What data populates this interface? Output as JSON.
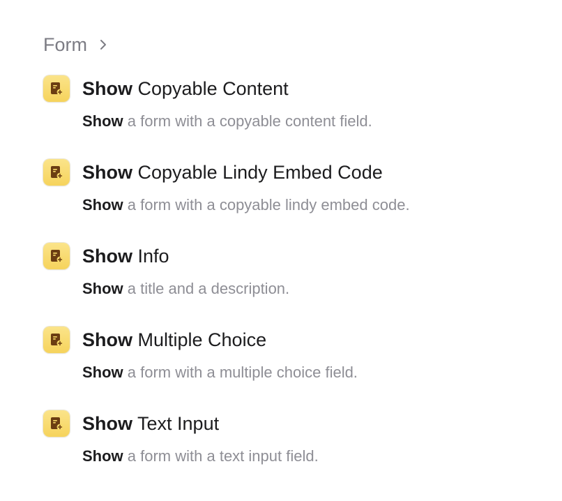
{
  "breadcrumb": {
    "label": "Form",
    "icon": "chevron-right-icon"
  },
  "colors": {
    "icon_background": "#f8da6a",
    "icon_glyph": "#6b3d12",
    "title_text": "#1c1c1e",
    "muted_text": "#8e8e95"
  },
  "actions": [
    {
      "icon": "form-add-icon",
      "title_verb": "Show",
      "title_rest": " Copyable Content",
      "desc_verb": "Show",
      "desc_rest": " a form with a copyable content field."
    },
    {
      "icon": "form-add-icon",
      "title_verb": "Show",
      "title_rest": " Copyable Lindy Embed Code",
      "desc_verb": "Show",
      "desc_rest": " a form with a copyable lindy embed code."
    },
    {
      "icon": "form-add-icon",
      "title_verb": "Show",
      "title_rest": " Info",
      "desc_verb": "Show",
      "desc_rest": " a title and a description."
    },
    {
      "icon": "form-add-icon",
      "title_verb": "Show",
      "title_rest": " Multiple Choice",
      "desc_verb": "Show",
      "desc_rest": " a form with a multiple choice field."
    },
    {
      "icon": "form-add-icon",
      "title_verb": "Show",
      "title_rest": " Text Input",
      "desc_verb": "Show",
      "desc_rest": " a form with a text input field."
    }
  ]
}
